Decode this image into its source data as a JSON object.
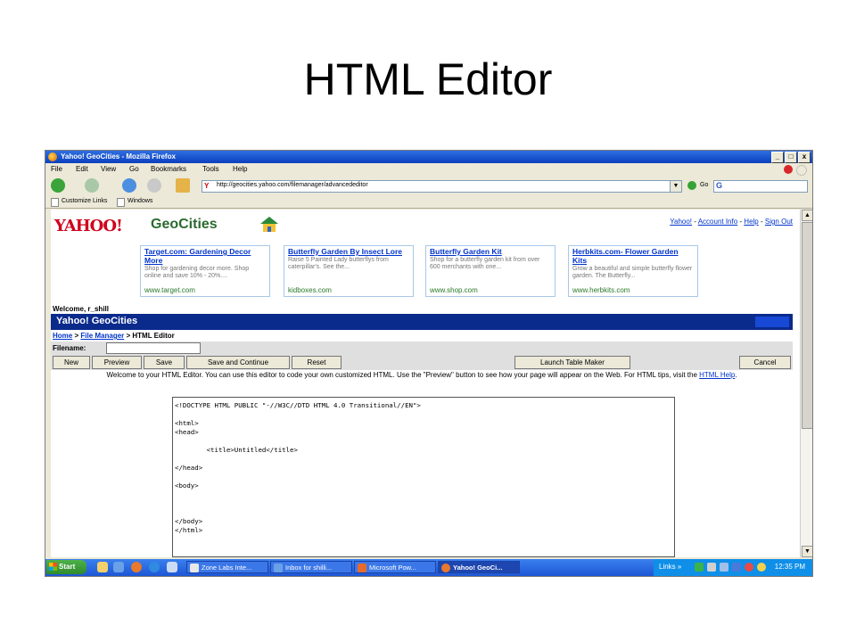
{
  "slide_title": "HTML Editor",
  "window": {
    "title": "Yahoo! GeoCities - Mozilla Firefox",
    "controls": [
      "_",
      "□",
      "x"
    ]
  },
  "menu": [
    "File",
    "Edit",
    "View",
    "Go",
    "Bookmarks",
    "Tools",
    "Help"
  ],
  "nav": {
    "url": "http://geocities.yahoo.com/filemanager/advancededitor",
    "go_label": "Go",
    "search_logo": "G"
  },
  "bookmarks": [
    "Customize Links",
    "Windows"
  ],
  "page": {
    "logo_yahoo": "YAHOO!",
    "logo_geocities": "GeoCities",
    "top_links": [
      "Yahoo!",
      "Account Info",
      "Help",
      "Sign Out"
    ],
    "link_sep": " - ",
    "ads": [
      {
        "title": "Target.com: Gardening Decor More",
        "desc": "Shop for gardening decor more. Shop online and save 10% - 20%....",
        "url": "www.target.com"
      },
      {
        "title": "Butterfly Garden By Insect Lore",
        "desc": "Raise 5 Painted Lady butterflys from caterpillar's. See the...",
        "url": "kidboxes.com"
      },
      {
        "title": "Butterfly Garden Kit",
        "desc": "Shop for a butterfly garden kit from over 600 merchants with one...",
        "url": "www.shop.com"
      },
      {
        "title": "Herbkits.com- Flower Garden Kits",
        "desc": "Grow a beautiful and simple butterfly flower garden. The Butterfly...",
        "url": "www.herbkits.com"
      }
    ],
    "welcome": "Welcome, r_shill",
    "banner": "Yahoo! GeoCities",
    "breadcrumb": {
      "home": "Home",
      "file_manager": "File Manager",
      "current": "HTML Editor",
      "sep": " > "
    },
    "filename_label": "Filename:",
    "filename_value": "",
    "buttons": {
      "new": "New",
      "preview": "Preview",
      "save": "Save",
      "save_continue": "Save and Continue",
      "reset": "Reset",
      "table_maker": "Launch Table Maker",
      "cancel": "Cancel"
    },
    "intro_text": "Welcome to your HTML Editor. You can use this editor to code your own customized HTML. Use the \"Preview\" button to see how your page will appear on the Web. For HTML tips, visit the",
    "intro_link": "HTML Help",
    "intro_end": ".",
    "editor_content": "<!DOCTYPE HTML PUBLIC \"-//W3C//DTD HTML 4.0 Transitional//EN\">\n\n<html>\n<head>\n\n        <title>Untitled</title>\n\n</head>\n\n<body>\n\n\n\n</body>\n</html>"
  },
  "taskbar": {
    "start": "Start",
    "tasks": [
      "Zone Labs Inte...",
      "Inbox for shilli...",
      "Microsoft Pow...",
      "Yahoo! GeoCi..."
    ],
    "links_label": "Links",
    "chevron": "»",
    "clock": "12:35 PM"
  }
}
